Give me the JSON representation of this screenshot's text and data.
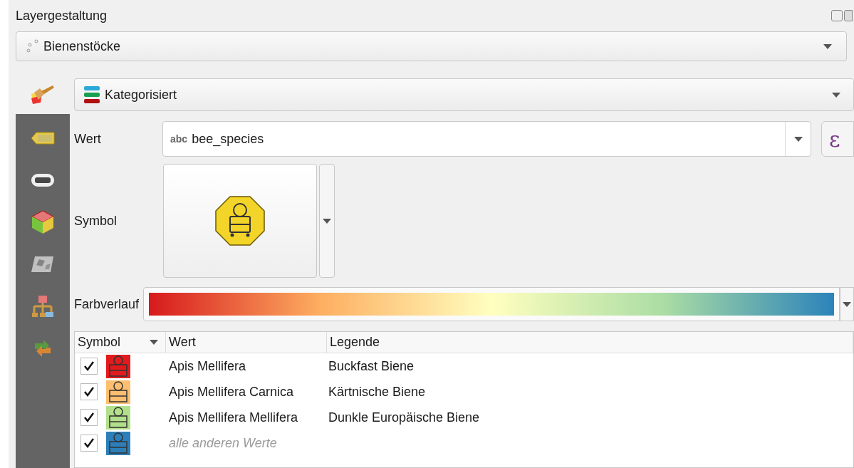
{
  "panel": {
    "title": "Layergestaltung"
  },
  "layer": {
    "name": "Bienenstöcke"
  },
  "sidebar_tabs": [
    {
      "kind": "symbology",
      "selected": true
    },
    {
      "kind": "labels",
      "selected": false
    },
    {
      "kind": "masks",
      "selected": false
    },
    {
      "kind": "rendering",
      "selected": false
    },
    {
      "kind": "elevation",
      "selected": false
    },
    {
      "kind": "diagrams",
      "selected": false
    },
    {
      "kind": "history",
      "selected": false
    }
  ],
  "renderer": {
    "value": "Kategorisiert"
  },
  "value_field": {
    "label": "Wert",
    "type_badge": "abc",
    "value": "bee_species",
    "expression_button": "ε"
  },
  "symbol": {
    "label": "Symbol"
  },
  "color_ramp": {
    "label": "Farbverlauf"
  },
  "table": {
    "columns": [
      "Symbol",
      "Wert",
      "Legende"
    ],
    "rows": [
      {
        "kind": "category",
        "checked": true,
        "color": "#e31a1c",
        "value": "Apis Mellifera",
        "legend": "Buckfast Biene"
      },
      {
        "kind": "category",
        "checked": true,
        "color": "#fdbf6f",
        "value": "Apis Mellifera Carnica",
        "legend": "Kärtnische Biene"
      },
      {
        "kind": "category",
        "checked": true,
        "color": "#b2df8a",
        "value": "Apis Mellifera Mellifera",
        "legend": "Dunkle Europäische Biene"
      },
      {
        "kind": "other",
        "checked": true,
        "color": "#2c7fb8",
        "value": "alle anderen Werte"
      }
    ]
  }
}
